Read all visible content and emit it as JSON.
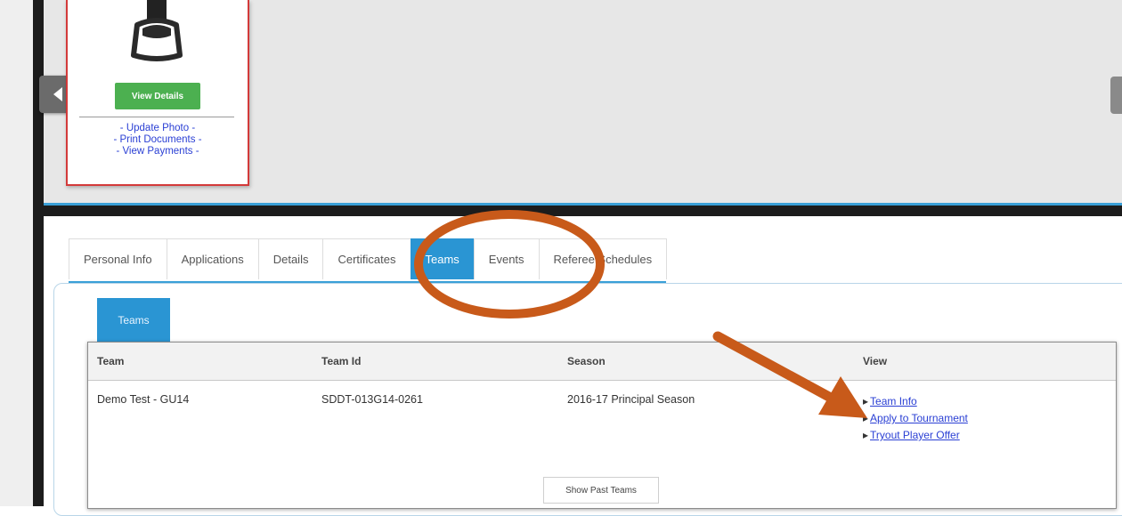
{
  "profile": {
    "view_details_label": "View Details",
    "links": [
      "- Update Photo -",
      "- Print Documents -",
      "- View Payments -"
    ]
  },
  "tabs": [
    {
      "label": "Personal Info"
    },
    {
      "label": "Applications"
    },
    {
      "label": "Details"
    },
    {
      "label": "Certificates"
    },
    {
      "label": "Teams",
      "active": true
    },
    {
      "label": "Events"
    },
    {
      "label": "Referee Schedules"
    }
  ],
  "teams_section": {
    "subtab_label": "Teams",
    "headers": {
      "team": "Team",
      "team_id": "Team Id",
      "season": "Season",
      "view": "View"
    },
    "row": {
      "team": "Demo Test - GU14",
      "team_id": "SDDT-013G14-0261",
      "season": "2016-17 Principal Season",
      "view_links": [
        "Team Info",
        "Apply to Tournament",
        "Tryout Player Offer"
      ]
    },
    "show_past_label": "Show Past Teams"
  },
  "colors": {
    "accent_blue": "#2a95d3",
    "annotation_orange": "#c85a1a",
    "button_green": "#4cb050",
    "card_border": "#d33a3a"
  }
}
